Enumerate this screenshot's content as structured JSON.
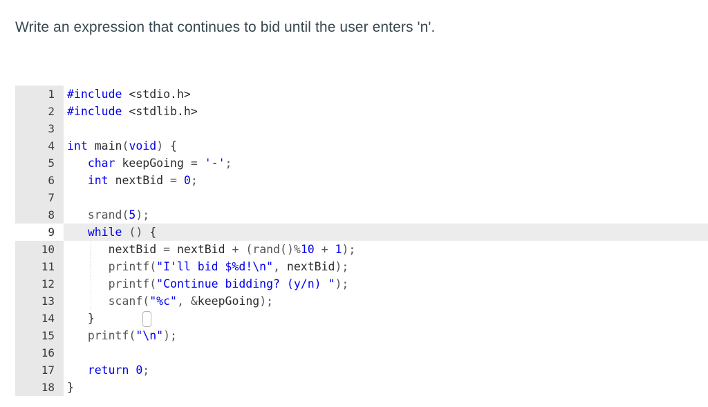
{
  "prompt": {
    "text": "Write an expression that continues to bid until the user enters 'n'."
  },
  "editor": {
    "language": "c",
    "active_line": 9,
    "caret_line": 9,
    "caret_column": 12,
    "first_line": 1,
    "last_line": 18,
    "colors": {
      "background": "#ffffff",
      "gutter_background": "#e8e8e8",
      "gutter_text": "#3c3c3c",
      "active_line_background": "#ececec",
      "active_line_gutter_background": "#ffffff",
      "keyword": "#0000ee",
      "string": "#0000ee",
      "number": "#0000ee",
      "identifier": "#2b2b2b",
      "function": "#555555",
      "operator": "#555555",
      "indent_guide": "#c8c8c8"
    },
    "lines": [
      {
        "number": "1",
        "active": false,
        "indent_guide": false,
        "tokens": [
          {
            "t": "#include",
            "c": "tok-kw"
          },
          {
            "t": " ",
            "c": "tok-pl"
          },
          {
            "t": "<stdio.h>",
            "c": "tok-pl"
          }
        ]
      },
      {
        "number": "2",
        "active": false,
        "indent_guide": false,
        "tokens": [
          {
            "t": "#include",
            "c": "tok-kw"
          },
          {
            "t": " ",
            "c": "tok-pl"
          },
          {
            "t": "<stdlib.h>",
            "c": "tok-pl"
          }
        ]
      },
      {
        "number": "3",
        "active": false,
        "indent_guide": false,
        "tokens": []
      },
      {
        "number": "4",
        "active": false,
        "indent_guide": false,
        "tokens": [
          {
            "t": "int",
            "c": "tok-kw"
          },
          {
            "t": " ",
            "c": "tok-pl"
          },
          {
            "t": "main",
            "c": "tok-id"
          },
          {
            "t": "(",
            "c": "tok-op"
          },
          {
            "t": "void",
            "c": "tok-kw"
          },
          {
            "t": ")",
            "c": "tok-op"
          },
          {
            "t": " ",
            "c": "tok-pl"
          },
          {
            "t": "{",
            "c": "tok-pl"
          }
        ]
      },
      {
        "number": "5",
        "active": false,
        "indent_guide": false,
        "tokens": [
          {
            "t": "   ",
            "c": "tok-pl"
          },
          {
            "t": "char",
            "c": "tok-kw"
          },
          {
            "t": " ",
            "c": "tok-pl"
          },
          {
            "t": "keepGoing",
            "c": "tok-id"
          },
          {
            "t": " ",
            "c": "tok-pl"
          },
          {
            "t": "=",
            "c": "tok-op"
          },
          {
            "t": " ",
            "c": "tok-pl"
          },
          {
            "t": "'-'",
            "c": "tok-str"
          },
          {
            "t": ";",
            "c": "tok-op"
          }
        ]
      },
      {
        "number": "6",
        "active": false,
        "indent_guide": false,
        "tokens": [
          {
            "t": "   ",
            "c": "tok-pl"
          },
          {
            "t": "int",
            "c": "tok-kw"
          },
          {
            "t": " ",
            "c": "tok-pl"
          },
          {
            "t": "nextBid",
            "c": "tok-id"
          },
          {
            "t": " ",
            "c": "tok-pl"
          },
          {
            "t": "=",
            "c": "tok-op"
          },
          {
            "t": " ",
            "c": "tok-pl"
          },
          {
            "t": "0",
            "c": "tok-num"
          },
          {
            "t": ";",
            "c": "tok-op"
          }
        ]
      },
      {
        "number": "7",
        "active": false,
        "indent_guide": false,
        "tokens": []
      },
      {
        "number": "8",
        "active": false,
        "indent_guide": false,
        "tokens": [
          {
            "t": "   ",
            "c": "tok-pl"
          },
          {
            "t": "srand",
            "c": "tok-fn"
          },
          {
            "t": "(",
            "c": "tok-op"
          },
          {
            "t": "5",
            "c": "tok-num"
          },
          {
            "t": ")",
            "c": "tok-op"
          },
          {
            "t": ";",
            "c": "tok-op"
          }
        ]
      },
      {
        "number": "9",
        "active": true,
        "indent_guide": false,
        "tokens": [
          {
            "t": "   ",
            "c": "tok-pl"
          },
          {
            "t": "while",
            "c": "tok-kw"
          },
          {
            "t": " ",
            "c": "tok-pl"
          },
          {
            "t": "(",
            "c": "tok-op"
          },
          {
            "t": ")",
            "c": "tok-op"
          },
          {
            "t": " ",
            "c": "tok-pl"
          },
          {
            "t": "{",
            "c": "tok-pl"
          }
        ]
      },
      {
        "number": "10",
        "active": false,
        "indent_guide": true,
        "tokens": [
          {
            "t": "      ",
            "c": "tok-pl"
          },
          {
            "t": "nextBid",
            "c": "tok-id"
          },
          {
            "t": " ",
            "c": "tok-pl"
          },
          {
            "t": "=",
            "c": "tok-op"
          },
          {
            "t": " ",
            "c": "tok-pl"
          },
          {
            "t": "nextBid",
            "c": "tok-id"
          },
          {
            "t": " ",
            "c": "tok-pl"
          },
          {
            "t": "+",
            "c": "tok-op"
          },
          {
            "t": " ",
            "c": "tok-pl"
          },
          {
            "t": "(",
            "c": "tok-op"
          },
          {
            "t": "rand",
            "c": "tok-fn"
          },
          {
            "t": "()",
            "c": "tok-op"
          },
          {
            "t": "%",
            "c": "tok-op"
          },
          {
            "t": "10",
            "c": "tok-num"
          },
          {
            "t": " ",
            "c": "tok-pl"
          },
          {
            "t": "+",
            "c": "tok-op"
          },
          {
            "t": " ",
            "c": "tok-pl"
          },
          {
            "t": "1",
            "c": "tok-num"
          },
          {
            "t": ")",
            "c": "tok-op"
          },
          {
            "t": ";",
            "c": "tok-op"
          }
        ]
      },
      {
        "number": "11",
        "active": false,
        "indent_guide": true,
        "tokens": [
          {
            "t": "      ",
            "c": "tok-pl"
          },
          {
            "t": "printf",
            "c": "tok-fn"
          },
          {
            "t": "(",
            "c": "tok-op"
          },
          {
            "t": "\"I'll bid $%d!\\n\"",
            "c": "tok-str"
          },
          {
            "t": ",",
            "c": "tok-op"
          },
          {
            "t": " ",
            "c": "tok-pl"
          },
          {
            "t": "nextBid",
            "c": "tok-id"
          },
          {
            "t": ")",
            "c": "tok-op"
          },
          {
            "t": ";",
            "c": "tok-op"
          }
        ]
      },
      {
        "number": "12",
        "active": false,
        "indent_guide": true,
        "tokens": [
          {
            "t": "      ",
            "c": "tok-pl"
          },
          {
            "t": "printf",
            "c": "tok-fn"
          },
          {
            "t": "(",
            "c": "tok-op"
          },
          {
            "t": "\"Continue bidding? (y/n) \"",
            "c": "tok-str"
          },
          {
            "t": ")",
            "c": "tok-op"
          },
          {
            "t": ";",
            "c": "tok-op"
          }
        ]
      },
      {
        "number": "13",
        "active": false,
        "indent_guide": true,
        "tokens": [
          {
            "t": "      ",
            "c": "tok-pl"
          },
          {
            "t": "scanf",
            "c": "tok-fn"
          },
          {
            "t": "(",
            "c": "tok-op"
          },
          {
            "t": "\"%c\"",
            "c": "tok-str"
          },
          {
            "t": ",",
            "c": "tok-op"
          },
          {
            "t": " ",
            "c": "tok-pl"
          },
          {
            "t": "&",
            "c": "tok-op"
          },
          {
            "t": "keepGoing",
            "c": "tok-id"
          },
          {
            "t": ")",
            "c": "tok-op"
          },
          {
            "t": ";",
            "c": "tok-op"
          }
        ]
      },
      {
        "number": "14",
        "active": false,
        "indent_guide": false,
        "tokens": [
          {
            "t": "   ",
            "c": "tok-pl"
          },
          {
            "t": "}",
            "c": "tok-pl"
          }
        ]
      },
      {
        "number": "15",
        "active": false,
        "indent_guide": false,
        "tokens": [
          {
            "t": "   ",
            "c": "tok-pl"
          },
          {
            "t": "printf",
            "c": "tok-fn"
          },
          {
            "t": "(",
            "c": "tok-op"
          },
          {
            "t": "\"\\n\"",
            "c": "tok-str"
          },
          {
            "t": ")",
            "c": "tok-op"
          },
          {
            "t": ";",
            "c": "tok-op"
          }
        ]
      },
      {
        "number": "16",
        "active": false,
        "indent_guide": false,
        "tokens": []
      },
      {
        "number": "17",
        "active": false,
        "indent_guide": false,
        "tokens": [
          {
            "t": "   ",
            "c": "tok-pl"
          },
          {
            "t": "return",
            "c": "tok-kw"
          },
          {
            "t": " ",
            "c": "tok-pl"
          },
          {
            "t": "0",
            "c": "tok-num"
          },
          {
            "t": ";",
            "c": "tok-op"
          }
        ]
      },
      {
        "number": "18",
        "active": false,
        "indent_guide": false,
        "tokens": [
          {
            "t": "}",
            "c": "tok-pl"
          }
        ]
      }
    ]
  }
}
